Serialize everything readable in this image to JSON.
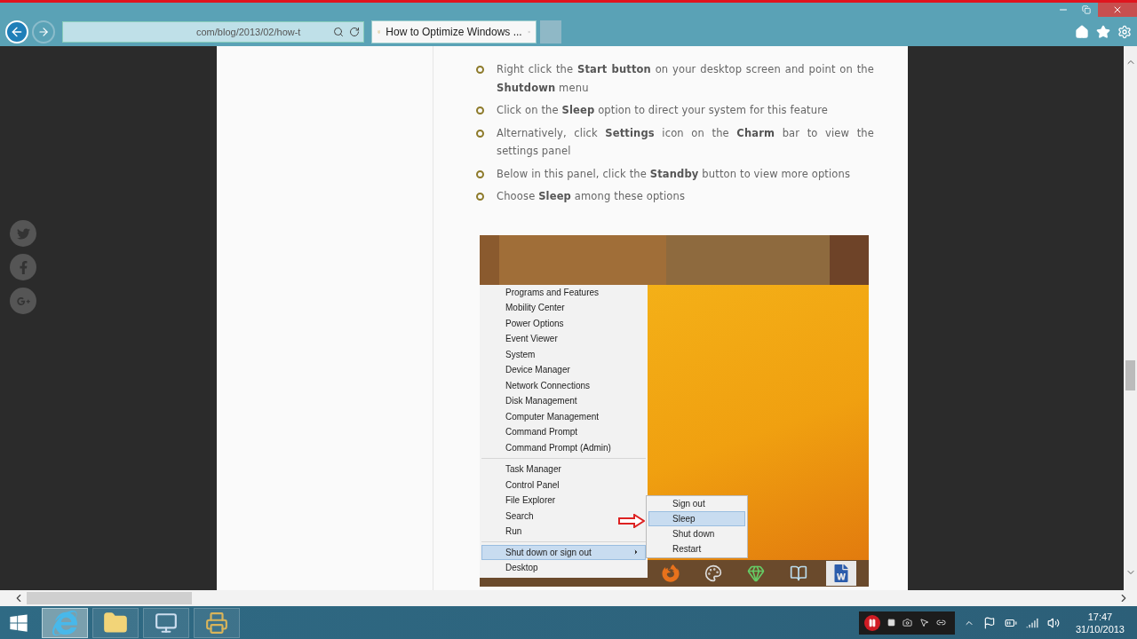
{
  "browser": {
    "address": "com/blog/2013/02/how-t",
    "tabs": [
      {
        "title": "How to Optimize Windows ...",
        "selected": true
      }
    ]
  },
  "article": {
    "steps": [
      "Right click the **Start button** on your desktop screen and point on the **Shutdown** menu",
      "Click on the **Sleep** option to direct your system for this feature",
      "Alternatively, click **Settings** icon on the **Charm** bar to view the settings panel",
      "Below in this panel, click the **Standby** button to view more options",
      "Choose **Sleep** among these options"
    ]
  },
  "screenshot": {
    "menu_groups": [
      [
        {
          "label": "Programs and Features",
          "selected": false
        },
        {
          "label": "Mobility Center",
          "selected": false
        },
        {
          "label": "Power Options",
          "selected": false
        },
        {
          "label": "Event Viewer",
          "selected": false
        },
        {
          "label": "System",
          "selected": false
        },
        {
          "label": "Device Manager",
          "selected": false
        },
        {
          "label": "Network Connections",
          "selected": false
        },
        {
          "label": "Disk Management",
          "selected": false
        },
        {
          "label": "Computer Management",
          "selected": false
        },
        {
          "label": "Command Prompt",
          "selected": false
        },
        {
          "label": "Command Prompt (Admin)",
          "selected": false
        }
      ],
      [
        {
          "label": "Task Manager",
          "selected": false
        },
        {
          "label": "Control Panel",
          "selected": false
        },
        {
          "label": "File Explorer",
          "selected": false
        },
        {
          "label": "Search",
          "selected": false
        },
        {
          "label": "Run",
          "selected": false
        }
      ],
      [
        {
          "label": "Shut down or sign out",
          "selected": true
        },
        {
          "label": "Desktop",
          "selected": false
        }
      ]
    ],
    "submenu": [
      {
        "label": "Sign out",
        "selected": false
      },
      {
        "label": "Sleep",
        "selected": true
      },
      {
        "label": "Shut down",
        "selected": false
      },
      {
        "label": "Restart",
        "selected": false
      }
    ]
  },
  "taskbar": {
    "apps": [
      {
        "kind": "browser",
        "selected": true
      },
      {
        "kind": "folder",
        "selected": false
      },
      {
        "kind": "monitor",
        "selected": false
      },
      {
        "kind": "printer",
        "selected": false
      }
    ],
    "clock": {
      "time": "17:47",
      "date": "31/10/2013"
    }
  }
}
